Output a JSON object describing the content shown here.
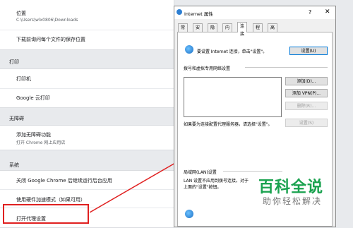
{
  "settings": {
    "location": {
      "label": "位置",
      "path": "C:\\Users\\wlx0806\\Downloads"
    },
    "ask_location": "下载前询问每个文件的保存位置",
    "print_section": "打印",
    "printer": "打印机",
    "cloud_print": "Google 云打印",
    "accessibility_section": "无障碍",
    "add_accessibility": {
      "label": "添加无障碍功能",
      "sub": "打开 Chrome 网上应用店"
    },
    "system_section": "系统",
    "background_apps": "关闭 Google Chrome 后继续运行后台应用",
    "hardware_accel": "使用硬件加速模式（如果可用）",
    "proxy_settings": "打开代理设置"
  },
  "dialog": {
    "title": "Internet 属性",
    "help": "?",
    "close": "✕",
    "tabs": [
      "常规",
      "安全",
      "隐私",
      "内容",
      "连接",
      "程序",
      "高级"
    ],
    "active_tab": 4,
    "setup_text": "要设置 Internet 连接，单击\"设置\"。",
    "setup_button": "设置(U)",
    "dialup_title": "拨号和虚拟专用网络设置",
    "add_button": "添加(D)...",
    "add_vpn_button": "添加 VPN(P)...",
    "remove_button": "删除(R)...",
    "settings_button": "设置(S)",
    "proxy_note": "如果要为连接配置代理服务器，请选择\"设置\"。",
    "lan_title": "局域网(LAN)设置",
    "lan_text_1": "LAN 设置不应用到拨号连接。对于",
    "lan_text_2": "上面的\"设置\"按钮。"
  },
  "watermark": {
    "logo": "百科全说",
    "sub": "助你轻松解决"
  }
}
